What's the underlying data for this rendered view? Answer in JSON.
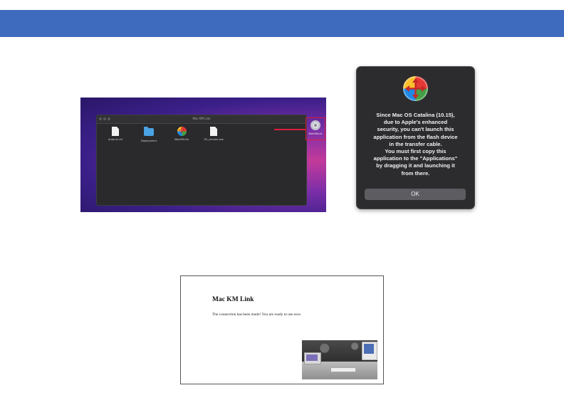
{
  "colors": {
    "header_bar": "#3f6bbf",
    "highlight": "#d8203a",
    "dialog_bg": "#2c2c2e"
  },
  "finder": {
    "window_title": "Mac KM Link",
    "items": [
      {
        "label": "Autorun.inf",
        "icon": "document-icon"
      },
      {
        "label": "Deployment",
        "icon": "folder-icon"
      },
      {
        "label": "MacKMLink",
        "icon": "app-icon"
      },
      {
        "label": "OS_version.exe",
        "icon": "document-icon"
      }
    ],
    "disk_label": "MacKMLink"
  },
  "dialog": {
    "lines": [
      "Since Mac OS Catalina (10.15),",
      "due to Apple's enhanced",
      "security, you can't launch this",
      "application from the flash device",
      "in the transfer cable.",
      "You must first copy this",
      "application to the \"Applications\"",
      "by dragging it and launching it",
      "from there."
    ],
    "ok_label": "OK"
  },
  "app_window": {
    "title": "Mac KM Link",
    "message": "The connection has been made! You are ready to use now."
  }
}
